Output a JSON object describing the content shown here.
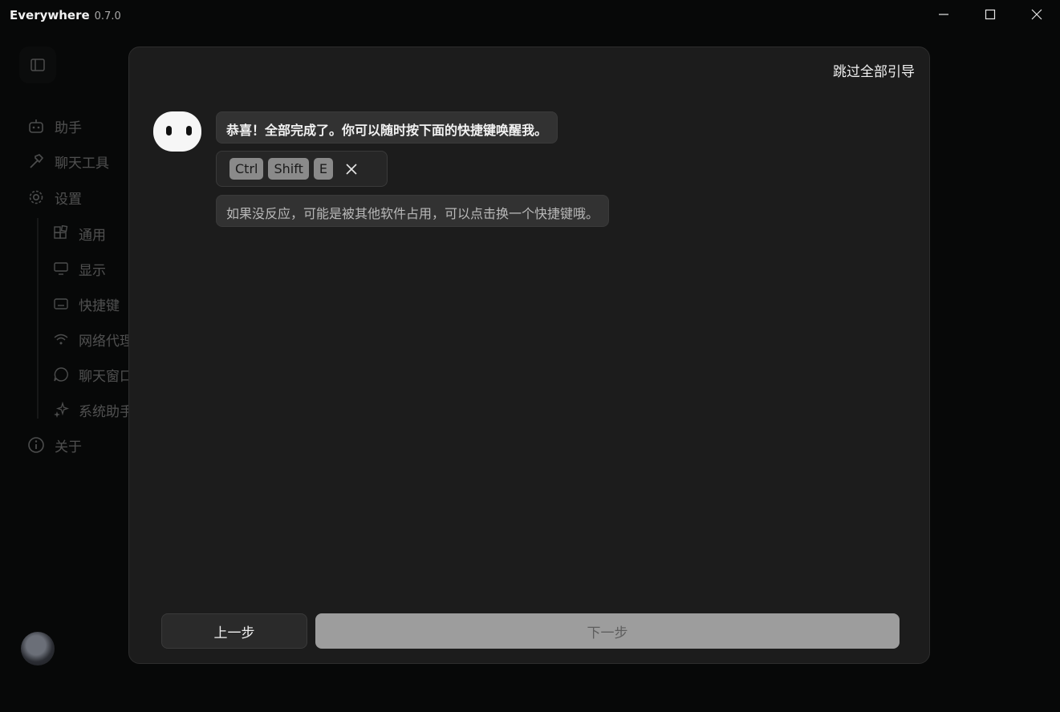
{
  "window": {
    "app_name": "Everywhere",
    "version": "0.7.0"
  },
  "sidebar": {
    "items": [
      {
        "label": "助手",
        "icon": "robot-icon"
      },
      {
        "label": "聊天工具",
        "icon": "hammer-icon"
      },
      {
        "label": "设置",
        "icon": "gear-icon"
      },
      {
        "label": "关于",
        "icon": "info-icon"
      }
    ],
    "settings_sub": [
      {
        "label": "通用",
        "icon": "apps-icon"
      },
      {
        "label": "显示",
        "icon": "monitor-icon"
      },
      {
        "label": "快捷键",
        "icon": "keyboard-icon"
      },
      {
        "label": "网络代理",
        "icon": "wifi-icon"
      },
      {
        "label": "聊天窗口",
        "icon": "chat-bubble-icon"
      },
      {
        "label": "系统助手",
        "icon": "sparkle-icon"
      }
    ]
  },
  "guide": {
    "skip_label": "跳过全部引导",
    "message_1": "恭喜！全部完成了。你可以随时按下面的快捷键唤醒我。",
    "shortcut_keys": [
      "Ctrl",
      "Shift",
      "E"
    ],
    "message_2": "如果没反应，可能是被其他软件占用，可以点击换一个快捷键哦。",
    "prev_label": "上一步",
    "next_label": "下一步"
  },
  "colors": {
    "background": "#070808",
    "modal": "#1c1c1c",
    "bubble": "#323232",
    "next_button": "#9d9d9d"
  }
}
